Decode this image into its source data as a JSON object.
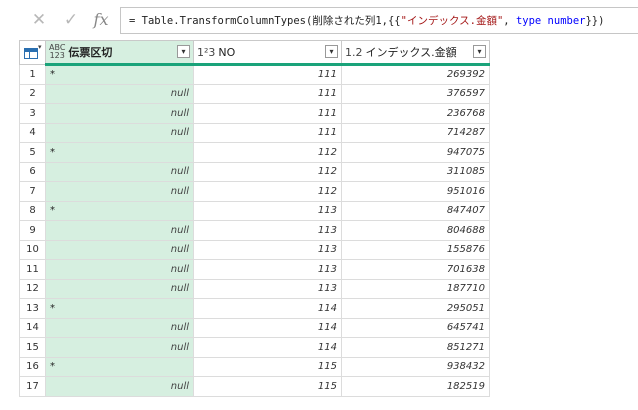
{
  "formula_bar": {
    "prefix": "= Table.TransformColumnTypes(削除された列1,{{",
    "string_literal": "\"インデックス.金額\"",
    "middle": ", ",
    "keyword": "type number",
    "suffix": "}})"
  },
  "icons": {
    "cancel": "✕",
    "commit": "✓",
    "fx": "fx",
    "dropdown": "▾"
  },
  "columns": [
    {
      "type_badge": "ABC\n123",
      "label": "伝票区切"
    },
    {
      "type_badge": "1²3",
      "label": "NO"
    },
    {
      "type_badge": "1.2",
      "label": "インデックス.金額"
    }
  ],
  "rows": [
    {
      "n": "1",
      "a": "*",
      "b": "111",
      "c": "269392"
    },
    {
      "n": "2",
      "a": "null",
      "b": "111",
      "c": "376597"
    },
    {
      "n": "3",
      "a": "null",
      "b": "111",
      "c": "236768"
    },
    {
      "n": "4",
      "a": "null",
      "b": "111",
      "c": "714287"
    },
    {
      "n": "5",
      "a": "*",
      "b": "112",
      "c": "947075"
    },
    {
      "n": "6",
      "a": "null",
      "b": "112",
      "c": "311085"
    },
    {
      "n": "7",
      "a": "null",
      "b": "112",
      "c": "951016"
    },
    {
      "n": "8",
      "a": "*",
      "b": "113",
      "c": "847407"
    },
    {
      "n": "9",
      "a": "null",
      "b": "113",
      "c": "804688"
    },
    {
      "n": "10",
      "a": "null",
      "b": "113",
      "c": "155876"
    },
    {
      "n": "11",
      "a": "null",
      "b": "113",
      "c": "701638"
    },
    {
      "n": "12",
      "a": "null",
      "b": "113",
      "c": "187710"
    },
    {
      "n": "13",
      "a": "*",
      "b": "114",
      "c": "295051"
    },
    {
      "n": "14",
      "a": "null",
      "b": "114",
      "c": "645741"
    },
    {
      "n": "15",
      "a": "null",
      "b": "114",
      "c": "851271"
    },
    {
      "n": "16",
      "a": "*",
      "b": "115",
      "c": "938432"
    },
    {
      "n": "17",
      "a": "null",
      "b": "115",
      "c": "182519"
    }
  ]
}
